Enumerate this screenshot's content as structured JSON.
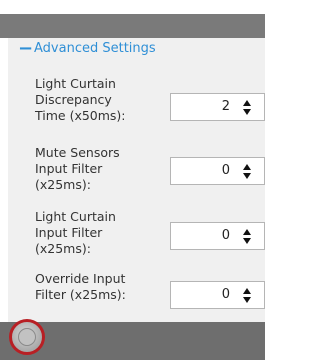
{
  "section": {
    "toggle_icon": "minus-icon",
    "title": "Advanced Settings"
  },
  "rows": [
    {
      "label_lines": [
        "Light Curtain",
        "Discrepancy",
        "Time (x50ms):"
      ],
      "value": "2"
    },
    {
      "label_lines": [
        "Mute Sensors",
        "Input Filter",
        "(x25ms):"
      ],
      "value": "0"
    },
    {
      "label_lines": [
        "Light Curtain",
        "Input Filter",
        "(x25ms):"
      ],
      "value": "0"
    },
    {
      "label_lines": [
        "Override Input",
        "Filter (x25ms):"
      ],
      "value": "0"
    }
  ],
  "colors": {
    "accent": "#2f8fd6",
    "header_bar": "#7a7a7a",
    "panel_bg": "#f0f0f0",
    "highlight_ring": "#b81f24"
  }
}
